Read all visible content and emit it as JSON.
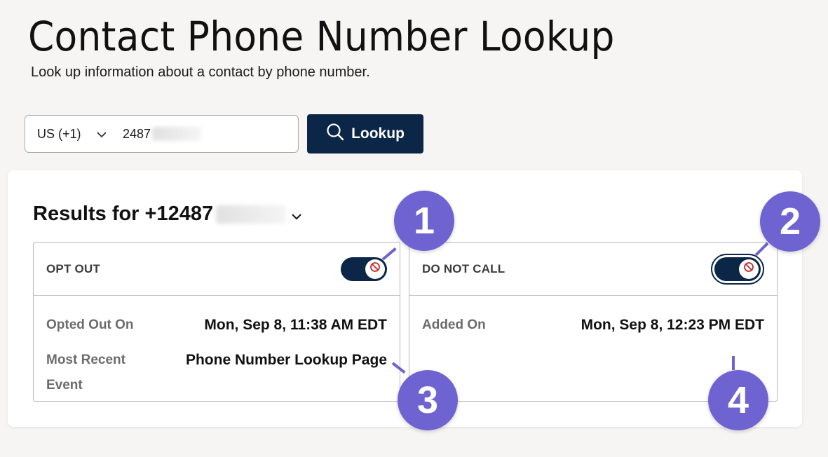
{
  "page": {
    "title": "Contact Phone Number Lookup",
    "subtitle": "Look up information about a contact by phone number."
  },
  "search": {
    "country_code": "US (+1)",
    "phone_value": "2487",
    "lookup_label": "Lookup"
  },
  "results": {
    "heading": "Results for +12487",
    "panels": [
      {
        "title": "OPT OUT",
        "toggle_on": true,
        "fields": [
          {
            "label": "Opted Out On",
            "value": "Mon, Sep 8, 11:38 AM EDT"
          },
          {
            "label": "Most Recent Event",
            "value": "Phone Number Lookup Page"
          }
        ]
      },
      {
        "title": "DO NOT CALL",
        "toggle_on": true,
        "fields": [
          {
            "label": "Added On",
            "value": "Mon, Sep 8, 12:23 PM EDT"
          }
        ]
      }
    ]
  },
  "callouts": [
    "1",
    "2",
    "3",
    "4"
  ],
  "colors": {
    "accent": "#0b2647",
    "callout": "#6e63d0",
    "background": "#f6f5f3",
    "block_icon": "#c62828"
  },
  "icons": {
    "search": "search-icon",
    "chevron": "chevron-down-icon",
    "toggle_knob": "block-icon"
  }
}
